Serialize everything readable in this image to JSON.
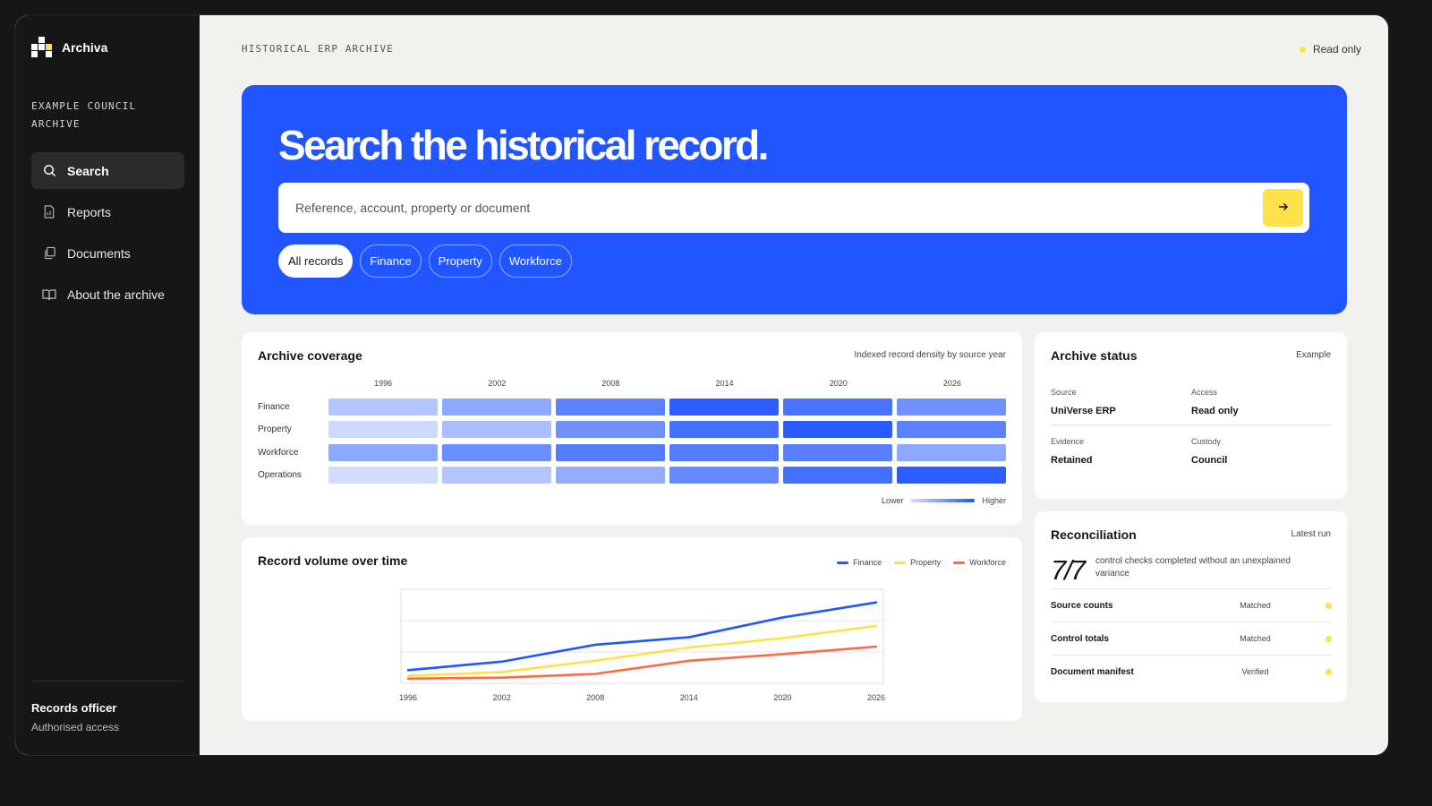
{
  "sidebar": {
    "brand": "Archiva",
    "org": "EXAMPLE COUNCIL ARCHIVE",
    "items": [
      {
        "label": "Search",
        "icon": "search-icon"
      },
      {
        "label": "Reports",
        "icon": "report-icon"
      },
      {
        "label": "Documents",
        "icon": "documents-icon"
      },
      {
        "label": "About the archive",
        "icon": "book-icon"
      }
    ],
    "user": {
      "name": "Records officer",
      "access": "Authorised access"
    }
  },
  "header": {
    "title": "HISTORICAL ERP ARCHIVE",
    "mode": "Read only"
  },
  "hero": {
    "heading": "Search the historical record.",
    "search_placeholder": "Reference, account, property or document",
    "filters": [
      "All records",
      "Finance",
      "Property",
      "Workforce"
    ]
  },
  "coverage": {
    "title": "Archive coverage",
    "note": "Indexed record density by source year",
    "years": [
      "1996",
      "2002",
      "2008",
      "2014",
      "2020",
      "2026"
    ],
    "rows": [
      {
        "label": "Finance",
        "levels": [
          0.25,
          0.45,
          0.7,
          0.95,
          0.8,
          0.6
        ]
      },
      {
        "label": "Property",
        "levels": [
          0.12,
          0.3,
          0.6,
          0.82,
          0.97,
          0.7
        ]
      },
      {
        "label": "Workforce",
        "levels": [
          0.45,
          0.62,
          0.75,
          0.75,
          0.72,
          0.45
        ]
      },
      {
        "label": "Operations",
        "levels": [
          0.1,
          0.25,
          0.42,
          0.65,
          0.82,
          0.95
        ]
      }
    ],
    "scale_low": "Lower",
    "scale_high": "Higher"
  },
  "chart_data": {
    "type": "line",
    "title": "Record volume over time",
    "x": [
      "1996",
      "2002",
      "2008",
      "2014",
      "2020",
      "2026"
    ],
    "ylim": [
      0,
      100
    ],
    "grid": true,
    "legend": "top-right",
    "series": [
      {
        "name": "Finance",
        "color": "#2155ff",
        "values": [
          14,
          23,
          41,
          49,
          70,
          86
        ]
      },
      {
        "name": "Property",
        "color": "#ffe14a",
        "values": [
          8,
          12,
          24,
          38,
          48,
          61
        ]
      },
      {
        "name": "Workforce",
        "color": "#ff6a45",
        "values": [
          5,
          6,
          10,
          24,
          31,
          39
        ]
      }
    ]
  },
  "status": {
    "title": "Archive status",
    "note": "Example",
    "fields": [
      [
        {
          "key": "Source",
          "value": "UniVerse ERP"
        },
        {
          "key": "Access",
          "value": "Read only"
        }
      ],
      [
        {
          "key": "Evidence",
          "value": "Retained"
        },
        {
          "key": "Custody",
          "value": "Council"
        }
      ]
    ]
  },
  "reconciliation": {
    "title": "Reconciliation",
    "note": "Latest run",
    "score": "7/7",
    "summary": "control checks completed without an unexplained variance",
    "checks": [
      {
        "name": "Source counts",
        "status": "Matched"
      },
      {
        "name": "Control totals",
        "status": "Matched"
      },
      {
        "name": "Document manifest",
        "status": "Verified"
      }
    ]
  },
  "colors": {
    "accent": "#2155ff",
    "highlight": "#ffe14a",
    "sidebar": "#161616"
  }
}
